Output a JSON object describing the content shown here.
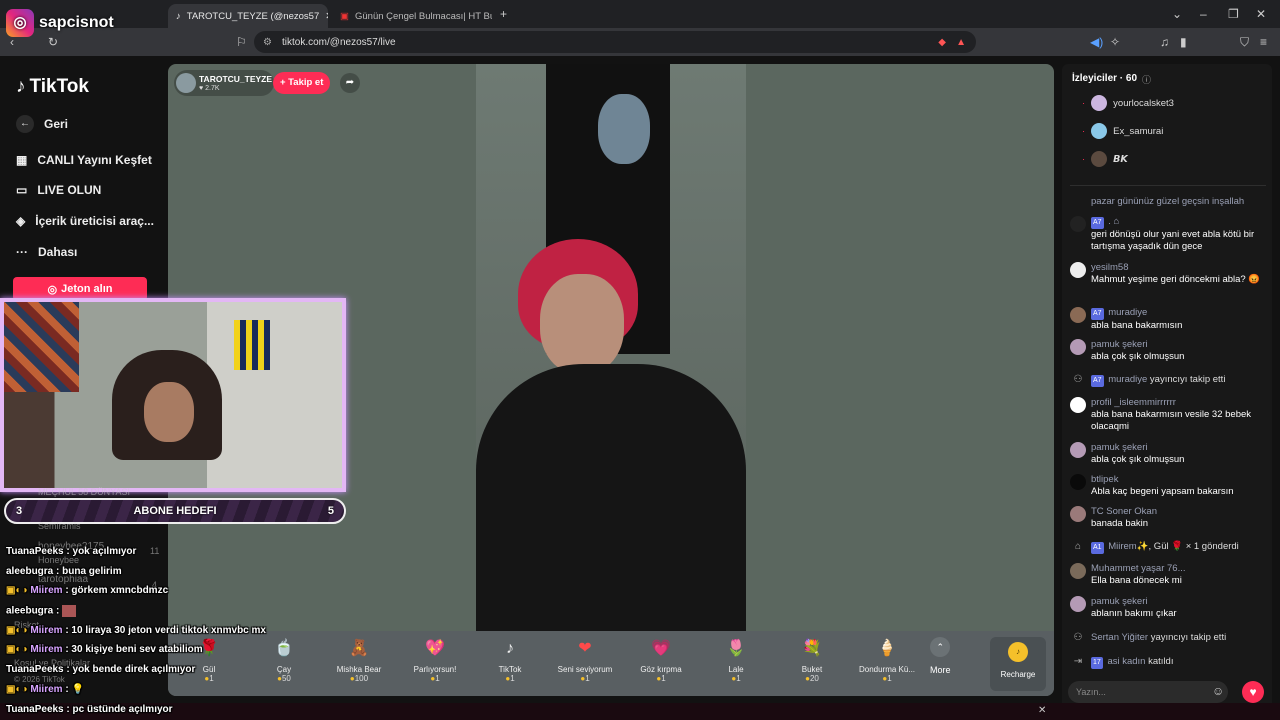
{
  "browser": {
    "tabs": [
      {
        "label": "TAROTCU_TEYZE (@nezos57"
      },
      {
        "label": "Günün Çengel Bulmacası| HT Bulmac"
      }
    ],
    "new_tab_glyph": "+",
    "url": "tiktok.com/@nezos57/live"
  },
  "overlay": {
    "channel": "sapcisnot",
    "abone": {
      "left": "3",
      "label": "ABONE HEDEFI",
      "right": "5"
    },
    "chat": [
      {
        "user": "TuanaPeeks",
        "text": ": yok açılmıyor"
      },
      {
        "user": "aleebugra",
        "text": ": buna gelirim"
      },
      {
        "user": "Miirem",
        "text": ": görkem xmncbdmzc"
      },
      {
        "user": "aleebugra",
        "text": ":"
      },
      {
        "user": "Miirem",
        "text": ": 10 liraya 30 jeton verdi tiktok xnmvbc mx"
      },
      {
        "user": "Miirem",
        "text": ": 30 kişiye beni sev atabiliom"
      },
      {
        "user": "TuanaPeeks",
        "text": ": yok bende direk açılmıyor"
      },
      {
        "user": "Miirem",
        "text": ":"
      },
      {
        "user": "TuanaPeeks",
        "text": ": pc üstünde açılmıyor"
      }
    ],
    "ghost_lines": [
      "MEÇHUL 58 DÜNYASI",
      "Semiramis",
      "honeybee2175",
      "Honeybee",
      "tarotophiaa",
      "Riskot",
      "Kosul ve Politikalar",
      "© 2026 TikTok"
    ],
    "ghost_count_11": "11",
    "ghost_count_4": "4"
  },
  "tiktok": {
    "brand": "TikTok",
    "nav": [
      {
        "label": "Geri",
        "icon": "←"
      },
      {
        "label": "CANLI Yayını Keşfet",
        "icon": "▦"
      },
      {
        "label": "LIVE OLUN",
        "icon": "▭"
      },
      {
        "label": "İçerik üreticisi araç...",
        "icon": "◈"
      },
      {
        "label": "Dahası",
        "icon": "···"
      }
    ],
    "jeton_button": "Jeton alın",
    "host": {
      "name": "TAROTCU_TEYZE",
      "likes": "2.7K",
      "follow": "+ Takip et"
    },
    "gifts": [
      {
        "name": "Gül",
        "cost": "1",
        "icon": "🌹"
      },
      {
        "name": "Çay",
        "cost": "50",
        "icon": "🍵"
      },
      {
        "name": "Mishka Bear",
        "cost": "100",
        "icon": "🧸"
      },
      {
        "name": "Parlıyorsun!",
        "cost": "1",
        "icon": "💖"
      },
      {
        "name": "TikTok",
        "cost": "1",
        "icon": "♪"
      },
      {
        "name": "Seni seviyorum",
        "cost": "1",
        "icon": "❤"
      },
      {
        "name": "Göz kırpma",
        "cost": "1",
        "icon": "💗"
      },
      {
        "name": "Lale",
        "cost": "1",
        "icon": "🌷"
      },
      {
        "name": "Buket",
        "cost": "20",
        "icon": "💐"
      },
      {
        "name": "Dondurma Kü...",
        "cost": "1",
        "icon": "🍦"
      }
    ],
    "more": "More",
    "recharge": "Recharge",
    "viewers_title": "İzleyiciler · 60",
    "viewers": [
      "yourlocalsket3",
      "Ex_samurai",
      "𝘽𝙆"
    ],
    "comments": [
      {
        "user": "",
        "text": "pazar gününüz güzel geçsin inşallah",
        "badge": ""
      },
      {
        "user": "",
        "text": "geri dönüşü olur yani evet abla kötü bir tartışma yaşadık dün gece",
        "badge": "A7"
      },
      {
        "user": "yesilm58",
        "text": "Mahmut yeşime geri döncekmi abla? 😡",
        "badge": ""
      },
      {
        "user": "muradiye",
        "text": "abla bana bakarmısın",
        "badge": "A7"
      },
      {
        "user": "pamuk şekeri",
        "text": "abla çok şık olmuşsun",
        "badge": ""
      },
      {
        "user": "muradiye",
        "text": "yayıncıyı takip etti",
        "badge": "A7"
      },
      {
        "user": "profil _isleemmirrrrrr",
        "text": "abla bana bakarmısın vesile 32 bebek olacaqmi",
        "badge": ""
      },
      {
        "user": "pamuk şekeri",
        "text": "abla çok şık olmuşsun",
        "badge": ""
      },
      {
        "user": "btlipek",
        "text": "Abla kaç begeni yapsam bakarsın",
        "badge": ""
      },
      {
        "user": "TC Soner Okan",
        "text": "banada bakin",
        "badge": ""
      },
      {
        "user": "Miirem✨",
        "text": ", Gül 🌹 × 1 gönderdi",
        "badge": "A1"
      },
      {
        "user": "Muhammet yaşar 76...",
        "text": "Ella bana dönecek mi",
        "badge": ""
      },
      {
        "user": "pamuk şekeri",
        "text": "ablanın bakımı çıkar",
        "badge": ""
      },
      {
        "user": "Sertan Yiğiter",
        "text": "yayıncıyı takip etti",
        "badge": ""
      },
      {
        "user": "asi kadın",
        "text": "katıldı",
        "badge": "17"
      }
    ],
    "chat_placeholder": "Yazın..."
  }
}
